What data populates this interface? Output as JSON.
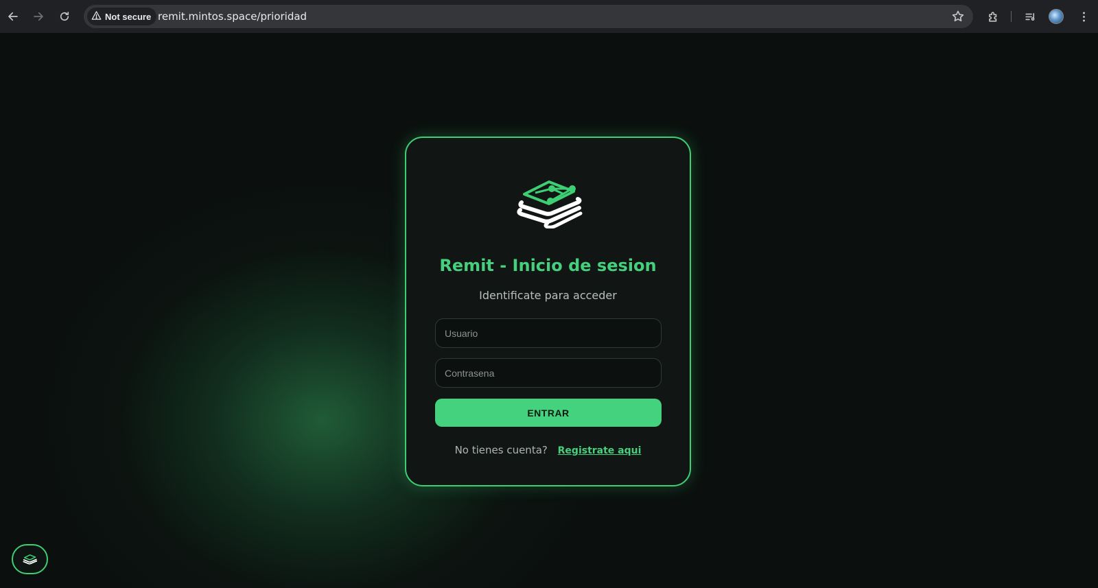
{
  "browser": {
    "security_label": "Not secure",
    "url": "remit.mintos.space/prioridad",
    "icons": [
      "back-icon",
      "forward-icon",
      "reload-icon",
      "warning-icon",
      "star-icon",
      "extensions-icon",
      "media-icon",
      "profile-avatar",
      "menu-icon"
    ]
  },
  "login": {
    "title": "Remit - Inicio de sesion",
    "subtitle": "Identificate para acceder",
    "username_placeholder": "Usuario",
    "password_placeholder": "Contrasena",
    "submit_label": "ENTRAR",
    "register_prompt": "No tienes cuenta?",
    "register_link": "Registrate aqui"
  },
  "colors": {
    "accent": "#46d07d",
    "card_border": "#3ecf74",
    "background": "#0b100e"
  }
}
